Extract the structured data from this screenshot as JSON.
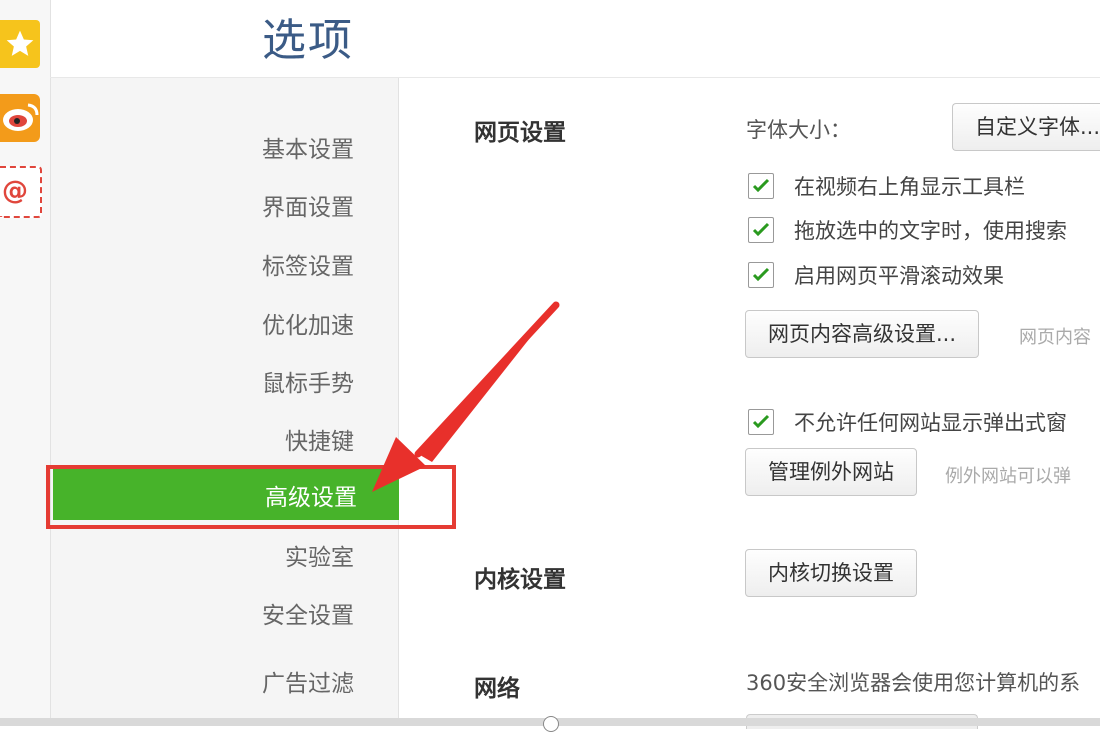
{
  "header": {
    "title": "选项"
  },
  "sidebar": {
    "items": [
      {
        "label": "基本设置"
      },
      {
        "label": "界面设置"
      },
      {
        "label": "标签设置"
      },
      {
        "label": "优化加速"
      },
      {
        "label": "鼠标手势"
      },
      {
        "label": "快捷键"
      },
      {
        "label": "高级设置",
        "active": true
      },
      {
        "label": "实验室"
      },
      {
        "label": "安全设置"
      },
      {
        "label": "广告过滤"
      }
    ]
  },
  "left_strip": {
    "icons": [
      "star-icon",
      "weibo-icon",
      "mail-at-icon"
    ],
    "mail_glyph": "@"
  },
  "webpage_settings": {
    "title": "网页设置",
    "font_size_label": "字体大小：",
    "custom_font_button": "自定义字体...",
    "checkboxes": [
      {
        "label": "在视频右上角显示工具栏",
        "checked": true
      },
      {
        "label": "拖放选中的文字时，使用搜索",
        "checked": true
      },
      {
        "label": "启用网页平滑滚动效果",
        "checked": true
      }
    ],
    "advanced_content_button": "网页内容高级设置...",
    "advanced_content_hint": "网页内容",
    "popup_checkbox": {
      "label": "不允许任何网站显示弹出式窗",
      "checked": true
    },
    "manage_exceptions_button": "管理例外网站",
    "manage_exceptions_hint": "例外网站可以弹"
  },
  "kernel_settings": {
    "title": "内核设置",
    "switch_button": "内核切换设置"
  },
  "network": {
    "title": "网络",
    "description": "360安全浏览器会使用您计算机的系"
  },
  "colors": {
    "active_nav": "#47b32a",
    "highlight": "#e53b33",
    "title": "#3b5b86"
  }
}
